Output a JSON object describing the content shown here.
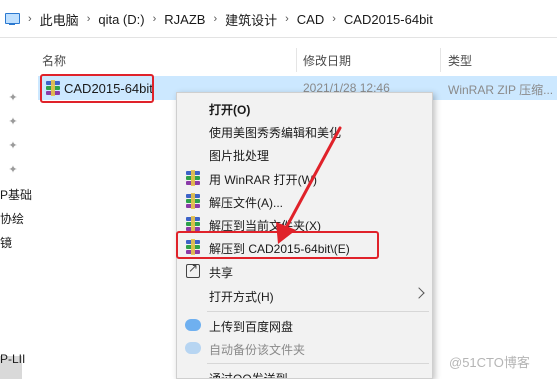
{
  "breadcrumb": [
    "此电脑",
    "qita (D:)",
    "RJAZB",
    "建筑设计",
    "CAD",
    "CAD2015-64bit"
  ],
  "nav": {
    "labels": [
      "P基础",
      "协绘",
      "镜",
      "P-LII"
    ]
  },
  "columns": {
    "name": "名称",
    "modified": "修改日期",
    "type": "类型"
  },
  "file": {
    "name": "CAD2015-64bit",
    "modified": "2021/1/28 12:46",
    "type": "WinRAR ZIP 压缩...",
    "icon": "winrar-icon"
  },
  "menu": {
    "items": [
      {
        "label": "打开(O)",
        "bold": true,
        "icon": ""
      },
      {
        "label": "使用美图秀秀编辑和美化",
        "icon": ""
      },
      {
        "label": "图片批处理",
        "icon": ""
      },
      {
        "label": "用 WinRAR 打开(W)",
        "icon": "winrar-icon"
      },
      {
        "label": "解压文件(A)...",
        "icon": "winrar-icon"
      },
      {
        "label": "解压到当前文件夹(X)",
        "icon": "winrar-icon"
      },
      {
        "label": "解压到 CAD2015-64bit\\(E)",
        "icon": "winrar-icon"
      },
      {
        "label": "共享",
        "icon": "share-icon"
      },
      {
        "label": "打开方式(H)",
        "icon": "",
        "submenu": true
      },
      {
        "label": "上传到百度网盘",
        "icon": "cloud-icon"
      },
      {
        "label": "自动备份该文件夹",
        "icon": "cloud-icon",
        "dim": true
      },
      {
        "label": "通过QQ发送到",
        "icon": ""
      }
    ]
  },
  "colors": {
    "selection": "#cce8ff",
    "highlight_border": "#e0222a",
    "arrow": "#e0222a"
  },
  "watermark": "@51CTO博客"
}
